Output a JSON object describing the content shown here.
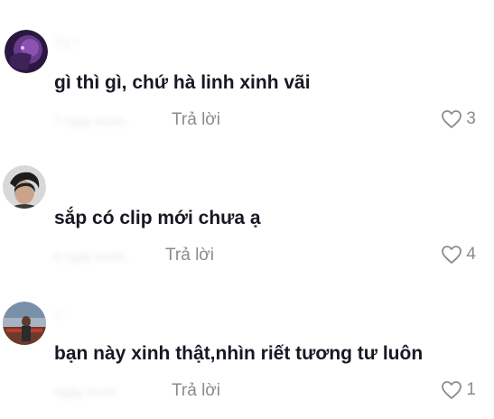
{
  "comments": [
    {
      "username": "trg t",
      "text": "gì thì gì, chứ hà linh xinh vãi",
      "meta": "7 ngày trước",
      "reply_label": "Trả lời",
      "likes": "3",
      "heart_icon": "heart-outline-icon"
    },
    {
      "username": "",
      "text": "sắp có clip mới chưa ạ",
      "meta": "8 ngày trước",
      "reply_label": "Trả lời",
      "likes": "4",
      "heart_icon": "heart-outline-icon"
    },
    {
      "username": "C",
      "text": "bạn này xinh thật,nhìn riết tương tư luôn",
      "meta": "Ngày trước",
      "reply_label": "Trả lời",
      "likes": "1",
      "heart_icon": "heart-outline-icon"
    }
  ],
  "colors": {
    "text": "#161823",
    "secondary": "#8a8b91",
    "background": "#ffffff"
  }
}
